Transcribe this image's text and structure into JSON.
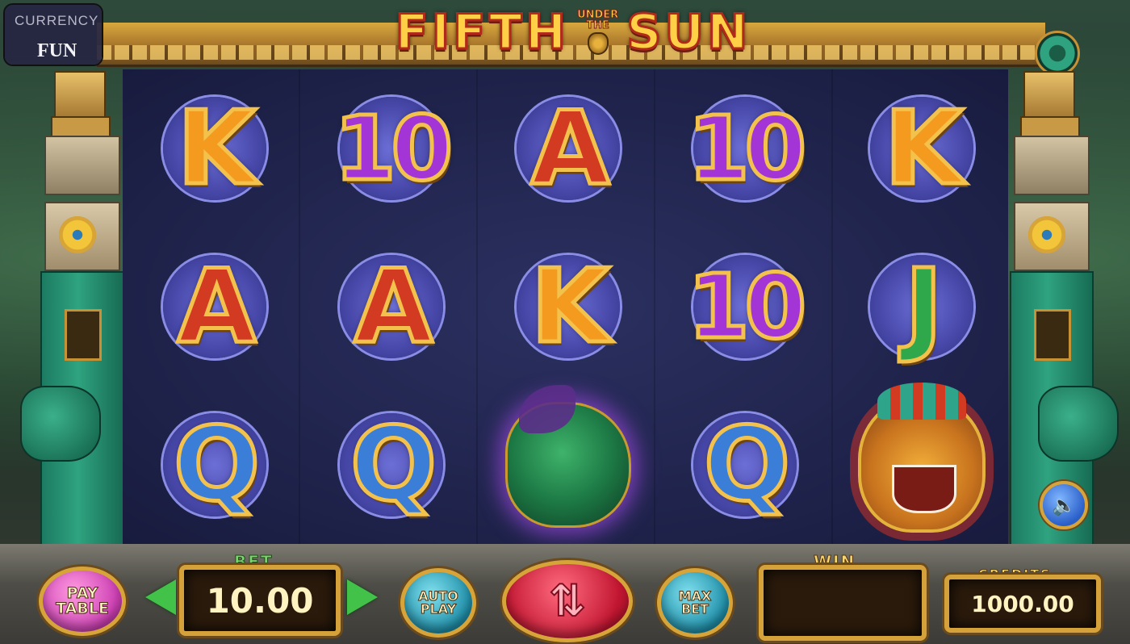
{
  "currency": {
    "label": "CURRENCY",
    "value": "FUN"
  },
  "game": {
    "title_part1": "FIFTH",
    "title_under": "UNDER",
    "title_the": "THE",
    "title_part2": "SUN"
  },
  "reels": [
    [
      "K",
      "10",
      "A",
      "10",
      "K"
    ],
    [
      "A",
      "A",
      "K",
      "10",
      "J"
    ],
    [
      "Q",
      "Q",
      "wild-serpent",
      "Q",
      "jaguar"
    ]
  ],
  "controls": {
    "paytable_label": "PAY\nTABLE",
    "bet_label": "BET",
    "bet_value": "10.00",
    "bet_decrease_icon": "arrow-left-icon",
    "bet_increase_icon": "arrow-right-icon",
    "autoplay_label": "AUTO\nPLAY",
    "spin_icon": "spin-arrows-icon",
    "maxbet_label": "MAX\nBET",
    "win_label": "WIN",
    "win_value": "",
    "credits_label": "CREDITS",
    "credits_value": "1000.00",
    "sound_icon": "speaker-icon"
  },
  "colors": {
    "reel_bg": "#1e2249",
    "gold": "#d4a13b",
    "jade": "#2fa37f"
  }
}
